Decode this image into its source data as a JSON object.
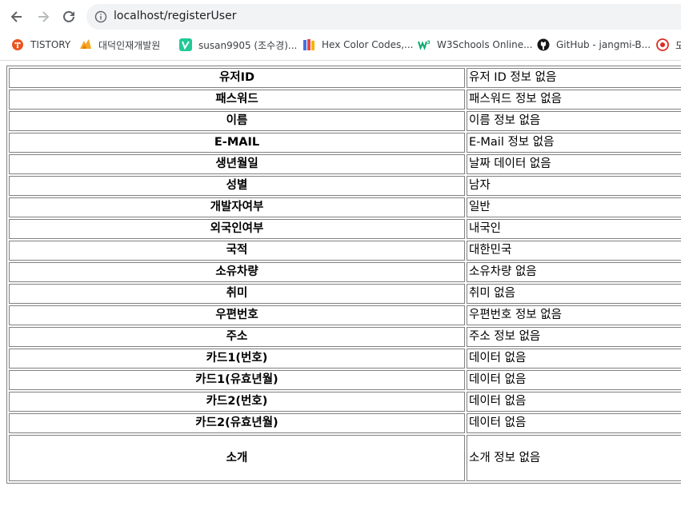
{
  "browser": {
    "url": "localhost/registerUser",
    "bookmarks": [
      {
        "label": "TISTORY",
        "icon": "tistory-icon",
        "color": "#eb531f"
      },
      {
        "label": "대덕인재개발원",
        "icon": "ddit-icon",
        "color": "#f5a623"
      },
      {
        "label": "susan9905 (조수경)...",
        "icon": "velog-icon",
        "color": "#20c997"
      },
      {
        "label": "Hex Color Codes,...",
        "icon": "books-icon",
        "color": "#4a6ee0"
      },
      {
        "label": "W3Schools Online...",
        "icon": "w3schools-icon",
        "color": "#04aa6d"
      },
      {
        "label": "GitHub - jangmi-B...",
        "icon": "github-icon",
        "color": "#181717"
      },
      {
        "label": "도",
        "icon": "red-circle-icon",
        "color": "#d93025"
      }
    ]
  },
  "table": {
    "rows": [
      {
        "label": "유저ID",
        "value": "유저 ID 정보 없음"
      },
      {
        "label": "패스워드",
        "value": "패스워드 정보 없음"
      },
      {
        "label": "이름",
        "value": "이름 정보 없음"
      },
      {
        "label": "E-MAIL",
        "value": "E-Mail 정보 없음"
      },
      {
        "label": "생년월일",
        "value": "날짜 데이터 없음"
      },
      {
        "label": "성별",
        "value": "남자"
      },
      {
        "label": "개발자여부",
        "value": "일반"
      },
      {
        "label": "외국인여부",
        "value": "내국인"
      },
      {
        "label": "국적",
        "value": "대한민국"
      },
      {
        "label": "소유차량",
        "value": "소유차량 없음"
      },
      {
        "label": "취미",
        "value": "취미 없음"
      },
      {
        "label": "우편번호",
        "value": "우편번호 정보 없음"
      },
      {
        "label": "주소",
        "value": "주소 정보 없음"
      },
      {
        "label": "카드1(번호)",
        "value": "데이터 없음"
      },
      {
        "label": "카드1(유효년월)",
        "value": "데이터 없음"
      },
      {
        "label": "카드2(번호)",
        "value": "데이터 없음"
      },
      {
        "label": "카드2(유효년월)",
        "value": "데이터 없음"
      },
      {
        "label": "소개",
        "value": "소개 정보 없음"
      }
    ]
  }
}
